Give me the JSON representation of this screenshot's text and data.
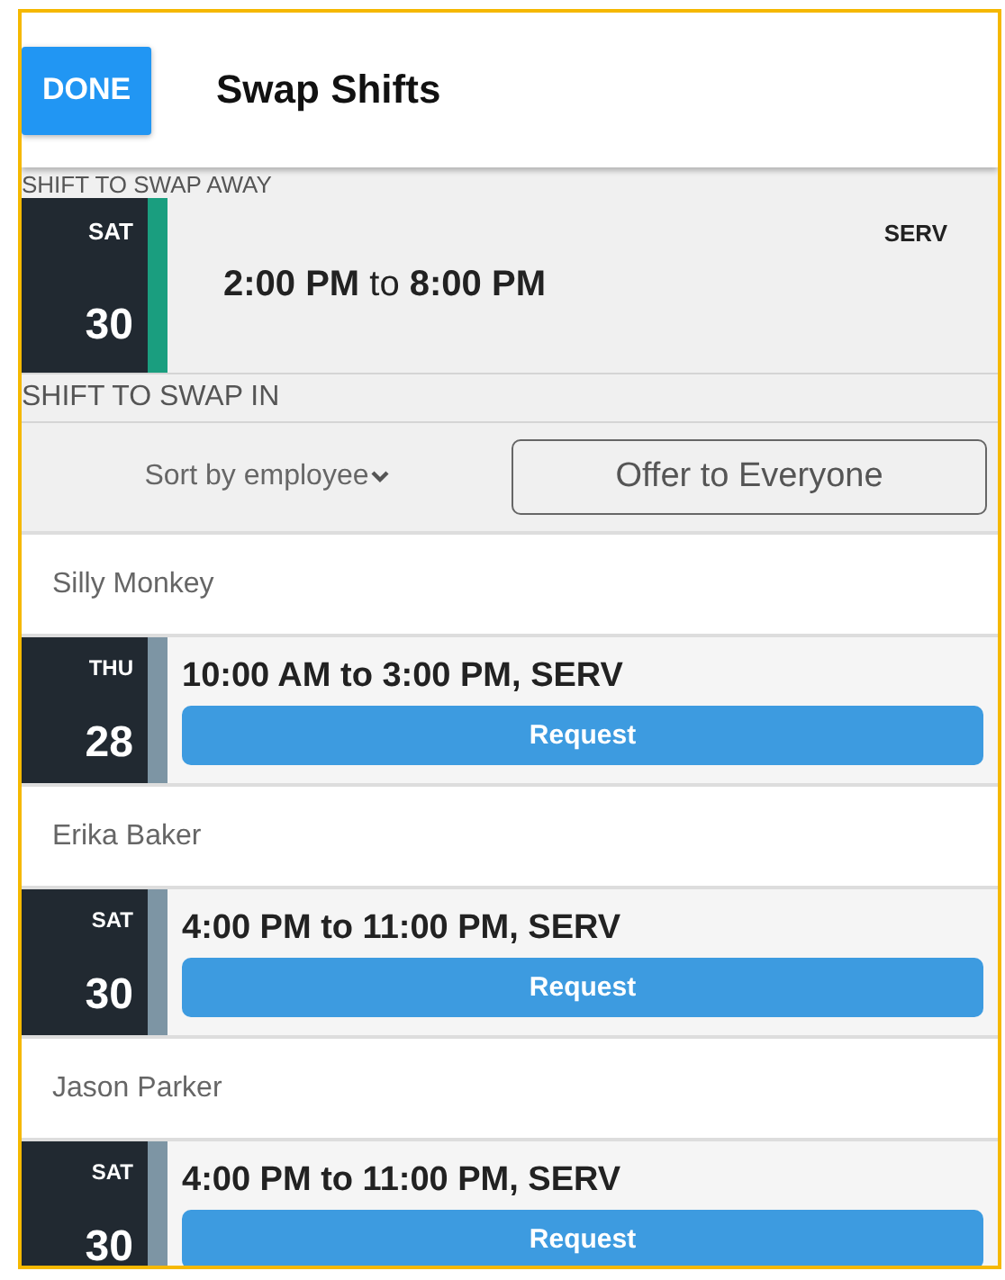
{
  "header": {
    "done_button": "DONE",
    "title": "Swap Shifts"
  },
  "swap_away": {
    "label": "SHIFT TO SWAP AWAY",
    "day": "SAT",
    "date": "30",
    "color": "#1a9e7f",
    "position": "SERV",
    "time": "**2:00 PM** to **8:00 PM**"
  },
  "swap_in": {
    "label": "SHIFT TO SWAP IN",
    "sort": "Sort by employee",
    "offer_button": "Offer to Everyone",
    "employees": [
      {
        "name": "Silly Monkey",
        "day": "THU",
        "date": "28",
        "color": "#7d95a4",
        "shift": "10:00 AM to 3:00 PM, SERV",
        "button": "Request"
      },
      {
        "name": "Erika Baker",
        "day": "SAT",
        "date": "30",
        "color": "#7d95a4",
        "shift": "4:00 PM to 11:00 PM, SERV",
        "button": "Request"
      },
      {
        "name": "Jason Parker",
        "day": "SAT",
        "date": "30",
        "color": "#7d95a4",
        "shift": "4:00 PM to 11:00 PM, SERV",
        "button": "Request"
      }
    ]
  }
}
